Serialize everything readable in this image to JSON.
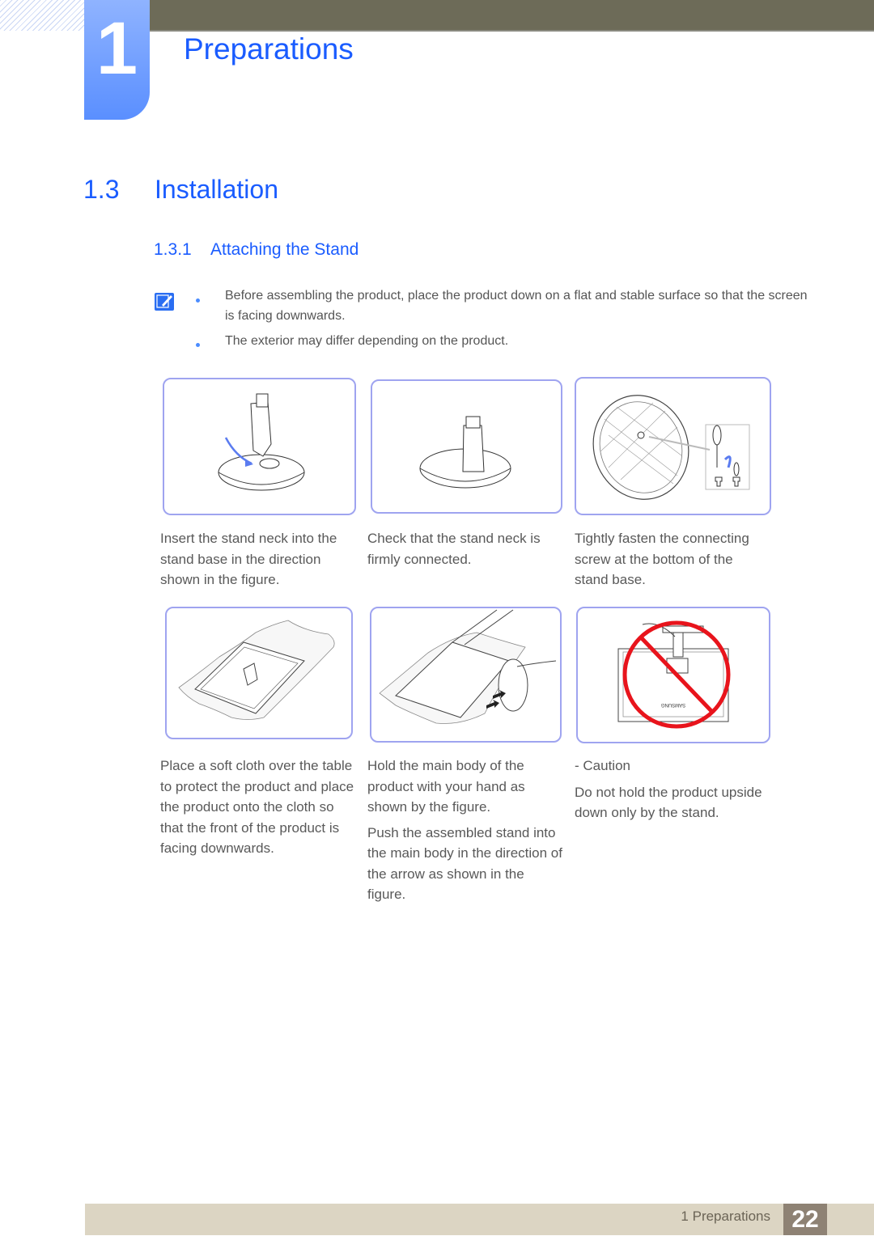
{
  "header": {
    "chapter_number": "1",
    "chapter_title": "Preparations"
  },
  "section": {
    "number": "1.3",
    "title": "Installation"
  },
  "subsection": {
    "number": "1.3.1",
    "title": "Attaching the Stand"
  },
  "notes": {
    "icon": "note-pencil-icon",
    "items": [
      "Before assembling the product, place the product down on a flat and stable surface so that the screen is facing downwards.",
      "The exterior may differ depending on the product."
    ]
  },
  "steps": [
    {
      "figure": "stand-neck-insert-figure",
      "caption": [
        "Insert the stand neck into the stand base in the direction shown in the figure."
      ]
    },
    {
      "figure": "stand-neck-connected-figure",
      "caption": [
        "Check that the stand neck is firmly connected."
      ]
    },
    {
      "figure": "stand-base-screw-figure",
      "caption": [
        "Tightly fasten the connecting screw at the bottom of the stand base."
      ]
    },
    {
      "figure": "soft-cloth-monitor-figure",
      "caption": [
        "Place a soft cloth over the table to protect the product and place the product onto the cloth so that the front of the product is facing downwards."
      ]
    },
    {
      "figure": "push-stand-into-body-figure",
      "caption": [
        "Hold the main body of the product with your hand as shown by the figure.",
        "Push the assembled stand into the main body in the direction of the arrow as shown in the figure."
      ]
    },
    {
      "figure": "caution-prohibited-figure",
      "caption": [
        "- Caution",
        "Do not hold the product upside down only by the stand."
      ]
    }
  ],
  "brand_text": "SAMSUNG",
  "colors": {
    "accent_blue": "#1a5cff",
    "figure_border": "#9fa4f0",
    "prohibit_red": "#e8141c",
    "footer_bg": "#dcd5c3",
    "page_num_bg": "#8e8274"
  },
  "footer": {
    "label": "1 Preparations",
    "page_number": "22"
  }
}
